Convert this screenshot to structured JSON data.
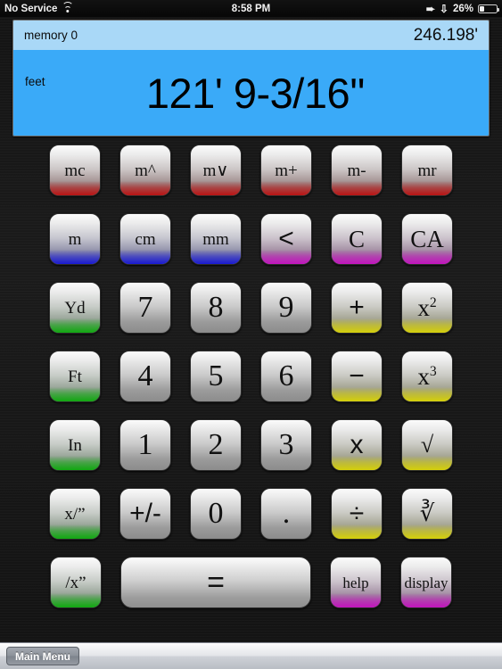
{
  "statusbar": {
    "carrier": "No Service",
    "wifi_icon": "wifi-icon",
    "time": "8:58 PM",
    "location_icon": "location-arrow-icon",
    "bluetooth_icon": "bluetooth-icon",
    "battery_percent": "26%",
    "battery_icon": "battery-icon",
    "battery_level": 26
  },
  "display": {
    "memory_label": "memory 0",
    "memory_value": "246.198'",
    "unit_label": "feet",
    "main_value": "121' 9-3/16''",
    "memory_bg": "#a9d8f7",
    "main_bg": "#3aaaf8"
  },
  "colors": {
    "memory_band": "#ba1414",
    "unit_metric_band": "#1a1ad2",
    "clear_band": "#c314be",
    "imperial_band": "#11a911",
    "operator_band": "#d6d10a"
  },
  "keypad": {
    "rows": [
      [
        {
          "label": "mc",
          "name": "memory-clear-button",
          "band": "red",
          "style": "small"
        },
        {
          "label": "m^",
          "name": "memory-up-button",
          "band": "red",
          "style": "small"
        },
        {
          "label": "m∨",
          "name": "memory-down-button",
          "band": "red",
          "style": "small"
        },
        {
          "label": "m+",
          "name": "memory-add-button",
          "band": "red",
          "style": "small"
        },
        {
          "label": "m-",
          "name": "memory-subtract-button",
          "band": "red",
          "style": "small"
        },
        {
          "label": "mr",
          "name": "memory-recall-button",
          "band": "red",
          "style": "small"
        }
      ],
      [
        {
          "label": "m",
          "name": "meter-button",
          "band": "blue",
          "style": "small"
        },
        {
          "label": "cm",
          "name": "centimeter-button",
          "band": "blue",
          "style": "small"
        },
        {
          "label": "mm",
          "name": "millimeter-button",
          "band": "blue",
          "style": "small"
        },
        {
          "label": "<",
          "name": "backspace-button",
          "band": "magenta",
          "style": "op"
        },
        {
          "label": "C",
          "name": "clear-button",
          "band": "magenta",
          "style": "key"
        },
        {
          "label": "CA",
          "name": "clear-all-button",
          "band": "magenta",
          "style": "key"
        }
      ],
      [
        {
          "label": "Yd",
          "name": "yard-button",
          "band": "green",
          "style": "small"
        },
        {
          "label": "7",
          "name": "digit-7-button",
          "band": "none",
          "style": "digit"
        },
        {
          "label": "8",
          "name": "digit-8-button",
          "band": "none",
          "style": "digit"
        },
        {
          "label": "9",
          "name": "digit-9-button",
          "band": "none",
          "style": "digit"
        },
        {
          "label": "+",
          "name": "add-button",
          "band": "yellow",
          "style": "op"
        },
        {
          "label": "x²",
          "name": "square-button",
          "band": "yellow",
          "style": "key",
          "sup": "2",
          "base": "x"
        }
      ],
      [
        {
          "label": "Ft",
          "name": "foot-button",
          "band": "green",
          "style": "small"
        },
        {
          "label": "4",
          "name": "digit-4-button",
          "band": "none",
          "style": "digit"
        },
        {
          "label": "5",
          "name": "digit-5-button",
          "band": "none",
          "style": "digit"
        },
        {
          "label": "6",
          "name": "digit-6-button",
          "band": "none",
          "style": "digit"
        },
        {
          "label": "−",
          "name": "subtract-button",
          "band": "yellow",
          "style": "op"
        },
        {
          "label": "x³",
          "name": "cube-button",
          "band": "yellow",
          "style": "key",
          "sup": "3",
          "base": "x"
        }
      ],
      [
        {
          "label": "In",
          "name": "inch-button",
          "band": "green",
          "style": "small"
        },
        {
          "label": "1",
          "name": "digit-1-button",
          "band": "none",
          "style": "digit"
        },
        {
          "label": "2",
          "name": "digit-2-button",
          "band": "none",
          "style": "digit"
        },
        {
          "label": "3",
          "name": "digit-3-button",
          "band": "none",
          "style": "digit"
        },
        {
          "label": "x",
          "name": "multiply-button",
          "band": "yellow",
          "style": "op"
        },
        {
          "label": "√",
          "name": "square-root-button",
          "band": "yellow",
          "style": "radical"
        }
      ],
      [
        {
          "label": "x/”",
          "name": "fraction-denominator-button",
          "band": "green",
          "style": "small"
        },
        {
          "label": "+/-",
          "name": "sign-toggle-button",
          "band": "none",
          "style": "op"
        },
        {
          "label": "0",
          "name": "digit-0-button",
          "band": "none",
          "style": "digit"
        },
        {
          "label": ".",
          "name": "decimal-point-button",
          "band": "none",
          "style": "digit"
        },
        {
          "label": "÷",
          "name": "divide-button",
          "band": "yellow",
          "style": "op"
        },
        {
          "label": "∛",
          "name": "cube-root-button",
          "band": "yellow",
          "style": "cuberoot"
        }
      ]
    ],
    "last_row": {
      "inverse": {
        "label": "/x”",
        "name": "inverse-fraction-button",
        "band": "green",
        "style": "small"
      },
      "equals": {
        "label": "=",
        "name": "equals-button",
        "band": "none"
      },
      "help": {
        "label": "help",
        "name": "help-button",
        "band": "magenta"
      },
      "display": {
        "label": "display",
        "name": "display-settings-button",
        "band": "magenta"
      }
    }
  },
  "toolbar": {
    "main_menu_label": "Main Menu"
  }
}
